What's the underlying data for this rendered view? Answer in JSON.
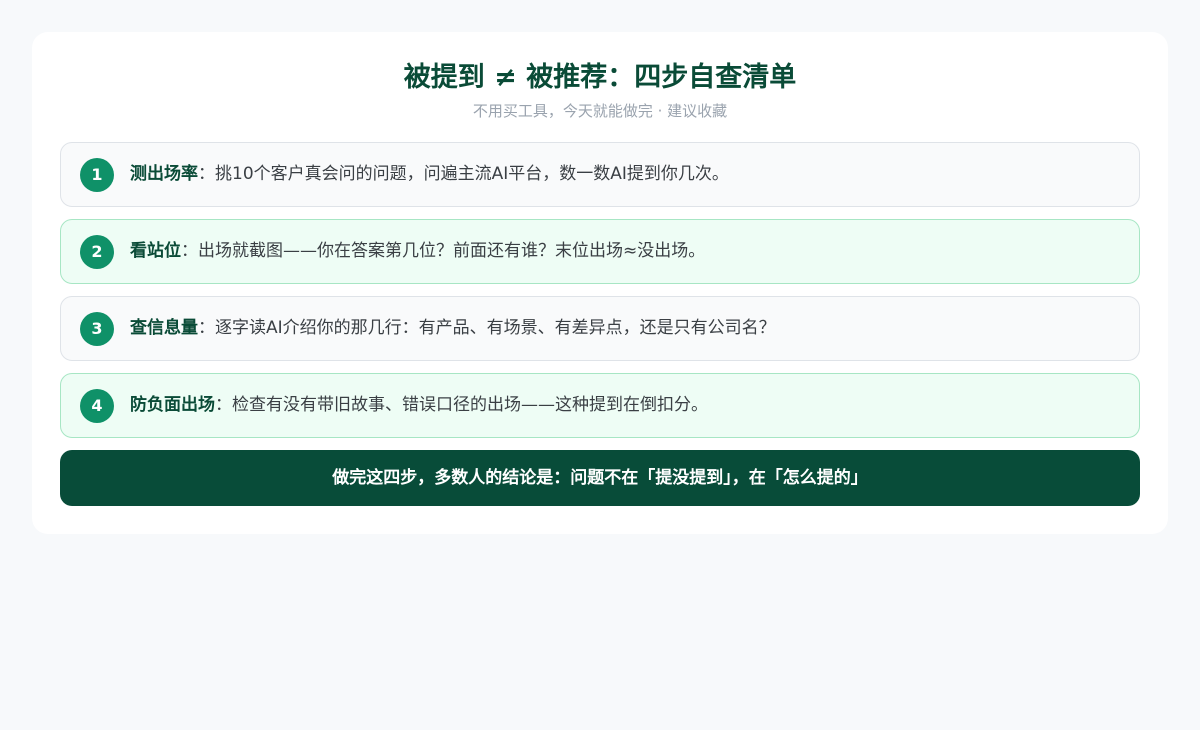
{
  "header": {
    "title": "被提到 ≠ 被推荐：四步自查清单",
    "subtitle": "不用买工具，今天就能做完 · 建议收藏"
  },
  "steps": [
    {
      "number": "1",
      "label": "测出场率",
      "separator": "：",
      "text": "挑10个客户真会问的问题，问遍主流AI平台，数一数AI提到你几次。"
    },
    {
      "number": "2",
      "label": "看站位",
      "separator": "：",
      "text": "出场就截图——你在答案第几位？前面还有谁？末位出场≈没出场。"
    },
    {
      "number": "3",
      "label": "查信息量",
      "separator": "：",
      "text": "逐字读AI介绍你的那几行：有产品、有场景、有差异点，还是只有公司名？"
    },
    {
      "number": "4",
      "label": "防负面出场",
      "separator": "：",
      "text": "检查有没有带旧故事、错误口径的出场——这种提到在倒扣分。"
    }
  ],
  "conclusion": {
    "text": "做完这四步，多数人的结论是：问题不在「提没提到」，在「怎么提的」"
  },
  "colors": {
    "accent_dark": "#084c39",
    "accent": "#0f9168",
    "highlight_bg": "#eefdf5"
  }
}
